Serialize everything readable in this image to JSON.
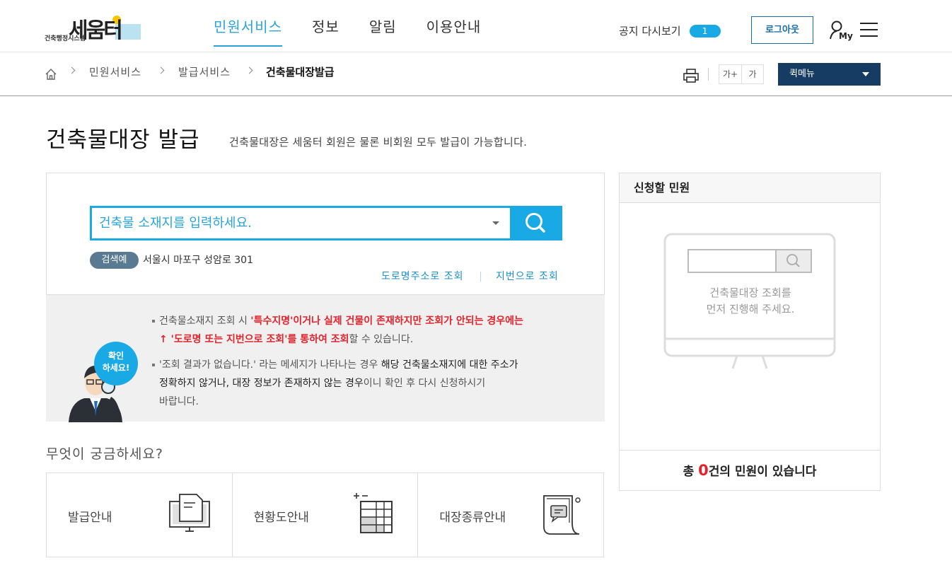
{
  "header": {
    "logo_sub": "건축행정시스템",
    "logo_main": "세움터",
    "nav": [
      "민원서비스",
      "정보",
      "알림",
      "이용안내"
    ],
    "notice_label": "공지 다시보기",
    "notice_count": "1",
    "logout_label": "로그아웃",
    "my_label": "My"
  },
  "breadcrumb": {
    "items": [
      "민원서비스",
      "발급서비스",
      "건축물대장발급"
    ],
    "font_buttons": [
      "가+",
      "가"
    ],
    "quick_menu": "퀵메뉴"
  },
  "page": {
    "title": "건축물대장 발급",
    "description": "건축물대장은 세움터 회원은 물론 비회원 모두 발급이 가능합니다."
  },
  "search": {
    "placeholder": "건축물 소재지를 입력하세요.",
    "example_badge": "검색예",
    "example_text": "서울시 마포구 성암로 301",
    "link_road": "도로명주소로 조회",
    "link_jibun": "지번으로 조회"
  },
  "info": {
    "bubble_line1": "확인",
    "bubble_line2": "하세요!",
    "item1_a": "건축물소재지 조회 시 ",
    "item1_b": "'특수지명'이거나 실제 건물이 존재하지만 조회가 안되는 경우에는",
    "item1_c": "↑ '도로명 또는 지번으로 조회'를 통하여 조회",
    "item1_d": "할 수 있습니다.",
    "item2_a": "'조회 결과가 없습니다.' 라는 메세지가 나타나는 경우 ",
    "item2_b": "해당 건축물소재지에 대한 주소가",
    "item2_c": "정확하지 않거나, 대장 정보가 존재하지 않는 경우",
    "item2_d": "이니 확인 후 다시 신청하시기",
    "item2_e": "바랍니다."
  },
  "faq": {
    "title": "무엇이 궁금하세요?",
    "cards": [
      "발급안내",
      "현황도안내",
      "대장종류안내"
    ]
  },
  "side": {
    "title": "신청할 민원",
    "message_line1": "건축물대장 조회를",
    "message_line2": "먼저 진행해 주세요.",
    "footer_prefix": "총 ",
    "footer_count": "0",
    "footer_suffix": "건의 민원이 있습니다"
  }
}
